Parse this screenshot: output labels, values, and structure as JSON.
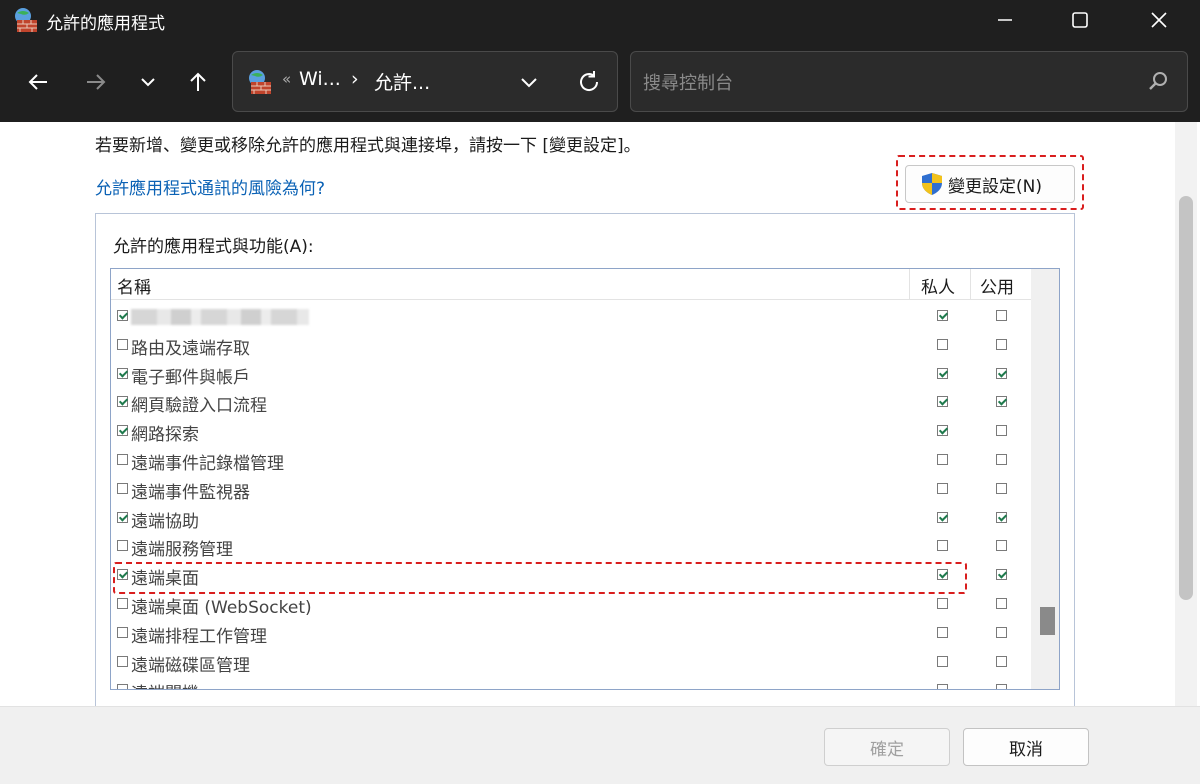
{
  "window": {
    "title": "允許的應用程式",
    "icon": "firewall-globe-icon"
  },
  "nav": {
    "back_icon": "arrow-left-icon",
    "forward_icon": "arrow-right-icon",
    "recent_icon": "chevron-down-icon",
    "up_icon": "arrow-up-icon",
    "address": {
      "overflow": "«",
      "crumb1": "Wi...",
      "separator": "›",
      "crumb2": "允許..."
    },
    "search_placeholder": "搜尋控制台"
  },
  "content": {
    "instruction": "若要新增、變更或移除允許的應用程式與連接埠，請按一下 [變更設定]。",
    "risk_link": "允許應用程式通訊的風險為何?",
    "change_settings": "變更設定(N)",
    "group_label": "允許的應用程式與功能(A):",
    "columns": {
      "name": "名稱",
      "private": "私人",
      "public": "公用"
    },
    "rows": [
      {
        "label": "",
        "blurred": true,
        "enabled": true,
        "private": true,
        "public": false
      },
      {
        "label": "路由及遠端存取",
        "enabled": false,
        "private": false,
        "public": false
      },
      {
        "label": "電子郵件與帳戶",
        "enabled": true,
        "private": true,
        "public": true
      },
      {
        "label": "網頁驗證入口流程",
        "enabled": true,
        "private": true,
        "public": true
      },
      {
        "label": "網路探索",
        "enabled": true,
        "private": true,
        "public": false
      },
      {
        "label": "遠端事件記錄檔管理",
        "enabled": false,
        "private": false,
        "public": false
      },
      {
        "label": "遠端事件監視器",
        "enabled": false,
        "private": false,
        "public": false
      },
      {
        "label": "遠端協助",
        "enabled": true,
        "private": true,
        "public": true
      },
      {
        "label": "遠端服務管理",
        "enabled": false,
        "private": false,
        "public": false
      },
      {
        "label": "遠端桌面",
        "enabled": true,
        "private": true,
        "public": true
      },
      {
        "label": "遠端桌面 (WebSocket)",
        "enabled": false,
        "private": false,
        "public": false
      },
      {
        "label": "遠端排程工作管理",
        "enabled": false,
        "private": false,
        "public": false
      },
      {
        "label": "遠端磁碟區管理",
        "enabled": false,
        "private": false,
        "public": false
      },
      {
        "label": "遠端關機",
        "enabled": false,
        "private": false,
        "public": false
      }
    ]
  },
  "footer": {
    "ok": "確定",
    "cancel": "取消"
  },
  "colors": {
    "titlebar": "#1f1f1f",
    "link": "#0b62b5",
    "highlight": "#d91e1e"
  }
}
